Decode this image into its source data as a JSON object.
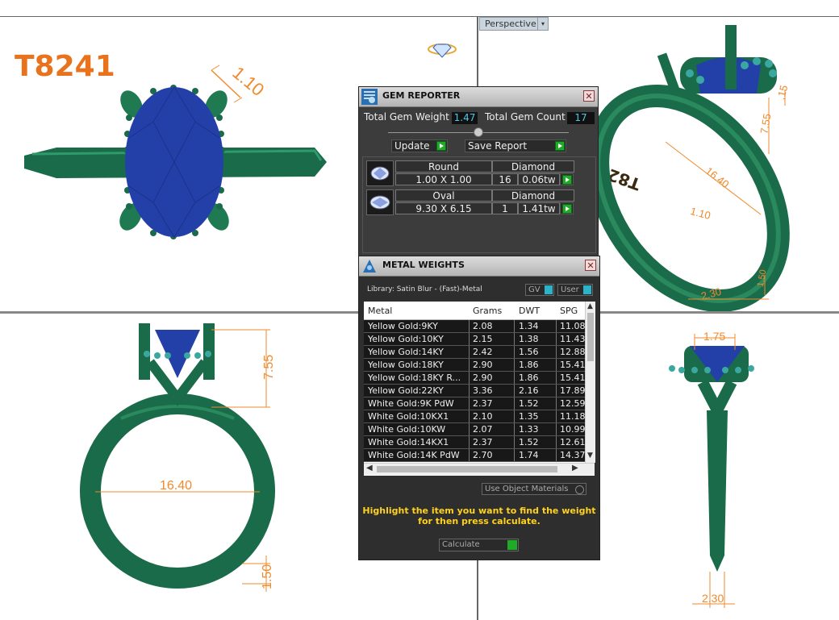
{
  "viewport": {
    "perspective_label": "Perspective"
  },
  "model": {
    "code": "T8241",
    "engraving": "T8241"
  },
  "dimensions": {
    "top_prong": "1.10",
    "persp_15": ".15",
    "persp_755": "7.55",
    "persp_1640": "16.40",
    "persp_110": "1.10",
    "persp_230": "2.30",
    "persp_150": "1.50",
    "front_755": "7.55",
    "front_1640": "16.40",
    "front_150": "1.50",
    "side_175": "1.75",
    "side_230": "2.30"
  },
  "gem_reporter": {
    "title": "GEM REPORTER",
    "total_weight_label": "Total Gem Weight",
    "total_weight": "1.47",
    "total_count_label": "Total Gem Count",
    "total_count": "17",
    "update_label": "Update",
    "save_label": "Save Report",
    "gems": [
      {
        "shape": "Round",
        "size": "1.00 X 1.00",
        "type": "Diamond",
        "count": "16",
        "weight": "0.06tw"
      },
      {
        "shape": "Oval",
        "size": "9.30 X 6.15",
        "type": "Diamond",
        "count": "1",
        "weight": "1.41tw"
      }
    ]
  },
  "metal_weights": {
    "title": "METAL WEIGHTS",
    "library": "Library: Satin Blur - (Fast)-Metal",
    "gv_label": "GV",
    "user_label": "User",
    "columns": [
      "Metal",
      "Grams",
      "DWT",
      "SPG"
    ],
    "rows": [
      [
        "Yellow Gold:9KY",
        "2.08",
        "1.34",
        "11.08"
      ],
      [
        "Yellow Gold:10KY",
        "2.15",
        "1.38",
        "11.43"
      ],
      [
        "Yellow Gold:14KY",
        "2.42",
        "1.56",
        "12.88"
      ],
      [
        "Yellow Gold:18KY",
        "2.90",
        "1.86",
        "15.41"
      ],
      [
        "Yellow Gold:18KY R...",
        "2.90",
        "1.86",
        "15.41"
      ],
      [
        "Yellow Gold:22KY",
        "3.36",
        "2.16",
        "17.89"
      ],
      [
        "White Gold:9K PdW",
        "2.37",
        "1.52",
        "12.59"
      ],
      [
        "White Gold:10KX1",
        "2.10",
        "1.35",
        "11.18"
      ],
      [
        "White Gold:10KW",
        "2.07",
        "1.33",
        "10.99"
      ],
      [
        "White Gold:14KX1",
        "2.37",
        "1.52",
        "12.61"
      ],
      [
        "White Gold:14K PdW",
        "2.70",
        "1.74",
        "14.37"
      ]
    ],
    "use_object_materials": "Use Object Materials",
    "hint_line1": "Highlight the item you want to find the weight",
    "hint_line2": "for then press calculate.",
    "calculate_label": "Calculate"
  },
  "colors": {
    "metal": "#1a6b4a",
    "stone": "#2340a8",
    "dimension": "#f08a2c",
    "panel": "#3c3c3c",
    "value_text": "#4ec6e8"
  }
}
